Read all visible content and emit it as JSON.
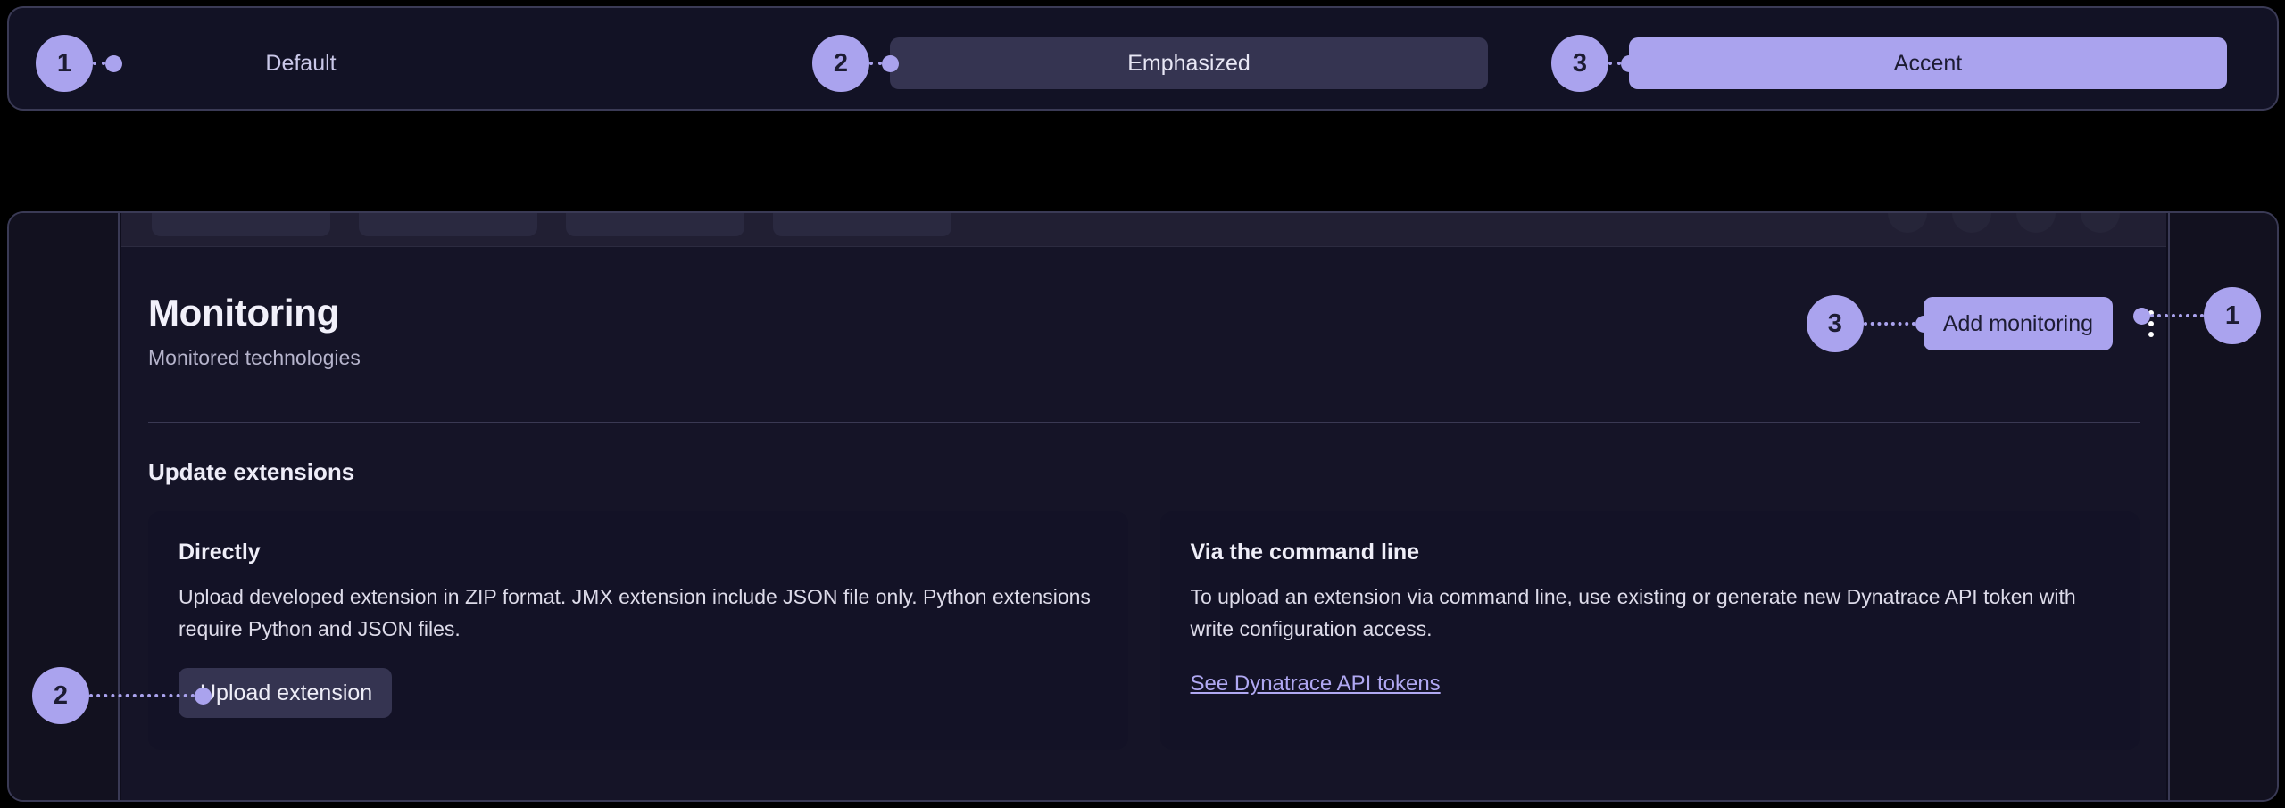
{
  "variant_panel": {
    "items": [
      {
        "badge": "1",
        "label": "Default",
        "style": "default"
      },
      {
        "badge": "2",
        "label": "Emphasized",
        "style": "emphasized"
      },
      {
        "badge": "3",
        "label": "Accent",
        "style": "accent"
      }
    ]
  },
  "app": {
    "header": {
      "title": "Monitoring",
      "subtitle": "Monitored technologies",
      "add_monitoring_label": "Add monitoring",
      "add_monitoring_badge": "3",
      "kebab_icon": "more-vertical-icon",
      "kebab_badge": "1"
    },
    "section": {
      "title": "Update extensions"
    },
    "cards": [
      {
        "heading": "Directly",
        "text": "Upload developed extension in ZIP format. JMX extension include JSON file only. Python extensions require Python and JSON files.",
        "button_label": "Upload extension",
        "button_badge": "2"
      },
      {
        "heading": "Via the command line",
        "text": "To upload an extension via command line, use existing or generate new Dynatrace API token with write configuration access.",
        "link_label": "See Dynatrace API tokens"
      }
    ]
  },
  "colors": {
    "accent": "#aaa3ee",
    "emphasized_bg": "#353451",
    "page_bg": "#000000",
    "panel_bg": "#121225",
    "panel_border": "#3a3a55",
    "content_bg": "#151427",
    "card_bg": "#131226",
    "title_text": "#f1f0fa",
    "muted_text": "#b6b4cc",
    "link_text": "#b0a8f2"
  }
}
